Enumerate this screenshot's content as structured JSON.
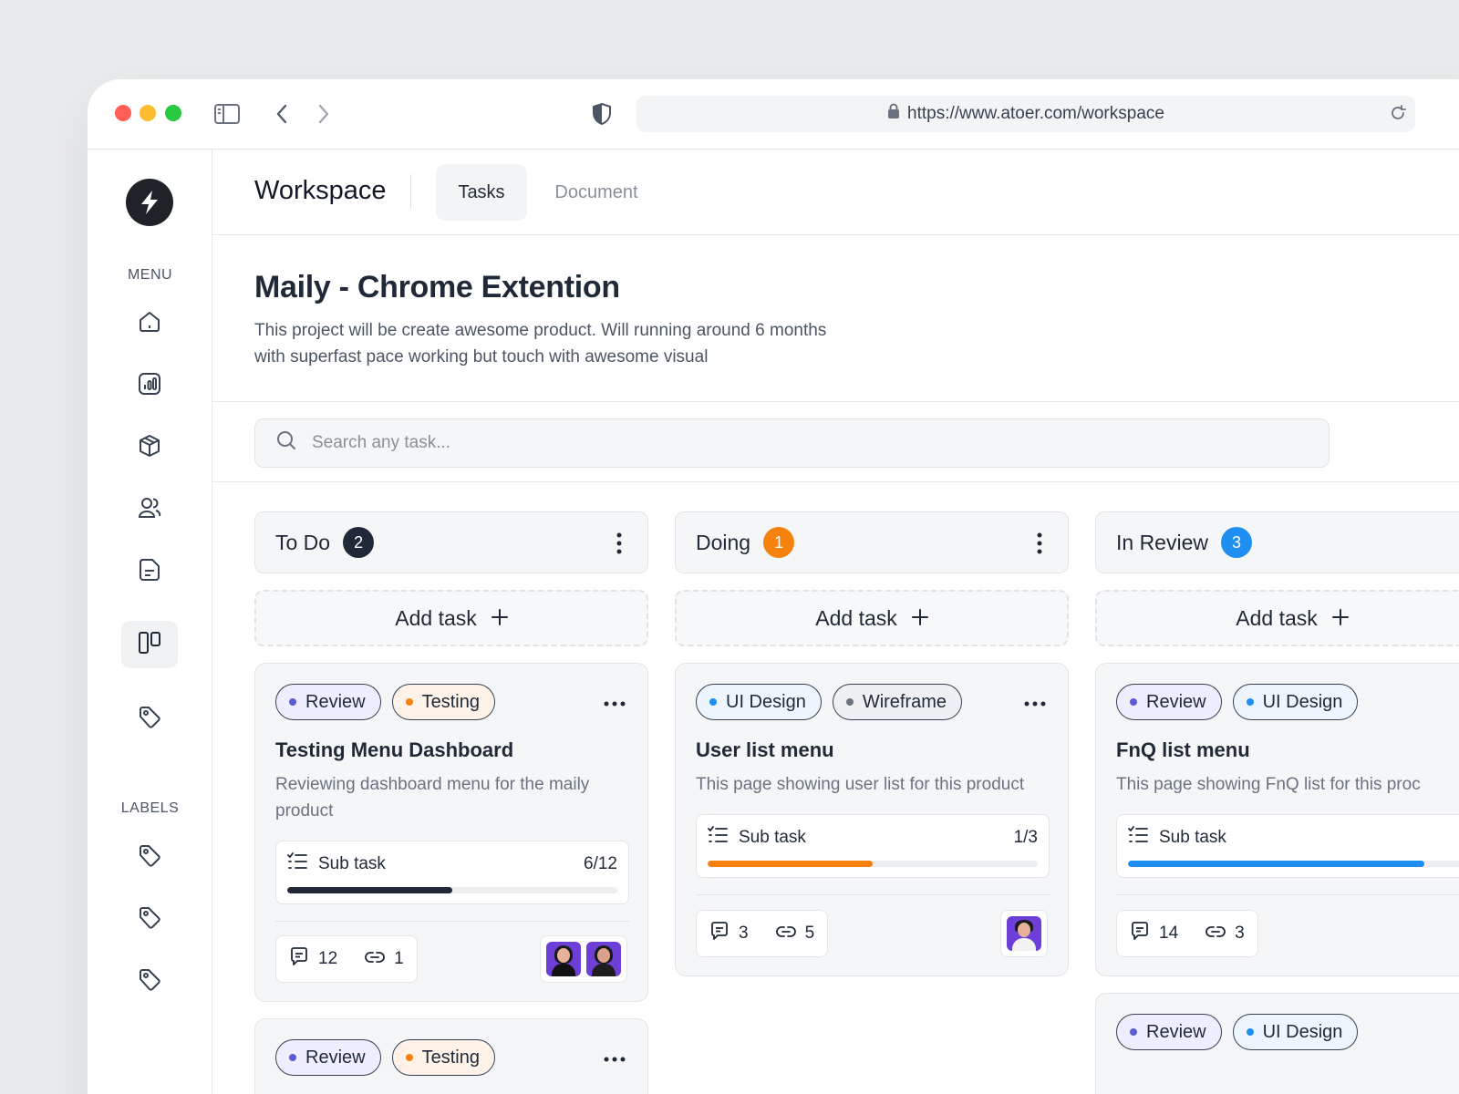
{
  "browser": {
    "url": "https://www.atoer.com/workspace"
  },
  "sidebar": {
    "menu_label": "MENU",
    "labels_label": "LABELS",
    "items": [
      {
        "icon": "home-icon"
      },
      {
        "icon": "analytics-icon"
      },
      {
        "icon": "box-icon"
      },
      {
        "icon": "users-icon"
      },
      {
        "icon": "document-icon"
      },
      {
        "icon": "board-icon",
        "active": true
      },
      {
        "icon": "tag-icon"
      }
    ],
    "label_items": [
      {
        "icon": "tag-icon"
      },
      {
        "icon": "tag-icon"
      },
      {
        "icon": "tag-icon"
      }
    ]
  },
  "header": {
    "title": "Workspace",
    "tabs": [
      {
        "label": "Tasks",
        "active": true
      },
      {
        "label": "Document",
        "active": false
      }
    ]
  },
  "project": {
    "title": "Maily - Chrome Extention",
    "description": "This project will be create awesome product. Will running around 6 months with superfast pace working but touch with awesome visual"
  },
  "search": {
    "placeholder": "Search any task..."
  },
  "colors": {
    "dark": "#1f2937",
    "orange": "#f5820c",
    "blue": "#1e8ff0",
    "purple_dot": "#5b5bd6"
  },
  "columns": [
    {
      "title": "To Do",
      "count": "2",
      "add_label": "Add task",
      "cards": [
        {
          "tags": [
            {
              "label": "Review"
            },
            {
              "label": "Testing"
            }
          ],
          "title": "Testing Menu Dashboard",
          "description": "Reviewing dashboard menu for the maily product",
          "subtask_label": "Sub task",
          "subtask_value": "6/12",
          "progress": 0.5,
          "comments": "12",
          "links": "1"
        },
        {
          "tags": [
            {
              "label": "Review"
            },
            {
              "label": "Testing"
            }
          ]
        }
      ]
    },
    {
      "title": "Doing",
      "count": "1",
      "add_label": "Add task",
      "cards": [
        {
          "tags": [
            {
              "label": "UI Design"
            },
            {
              "label": "Wireframe"
            }
          ],
          "title": "User list menu",
          "description": "This page showing user list for this product",
          "subtask_label": "Sub task",
          "subtask_value": "1/3",
          "progress": 0.5,
          "comments": "3",
          "links": "5"
        }
      ]
    },
    {
      "title": "In Review",
      "count": "3",
      "add_label": "Add task",
      "cards": [
        {
          "tags": [
            {
              "label": "Review"
            },
            {
              "label": "UI Design"
            }
          ],
          "title": "FnQ list menu",
          "description": "This page showing FnQ list for this proc",
          "subtask_label": "Sub task",
          "progress": 0.8,
          "comments": "14",
          "links": "3"
        },
        {
          "tags": [
            {
              "label": "Review"
            },
            {
              "label": "UI Design"
            }
          ]
        }
      ]
    }
  ]
}
